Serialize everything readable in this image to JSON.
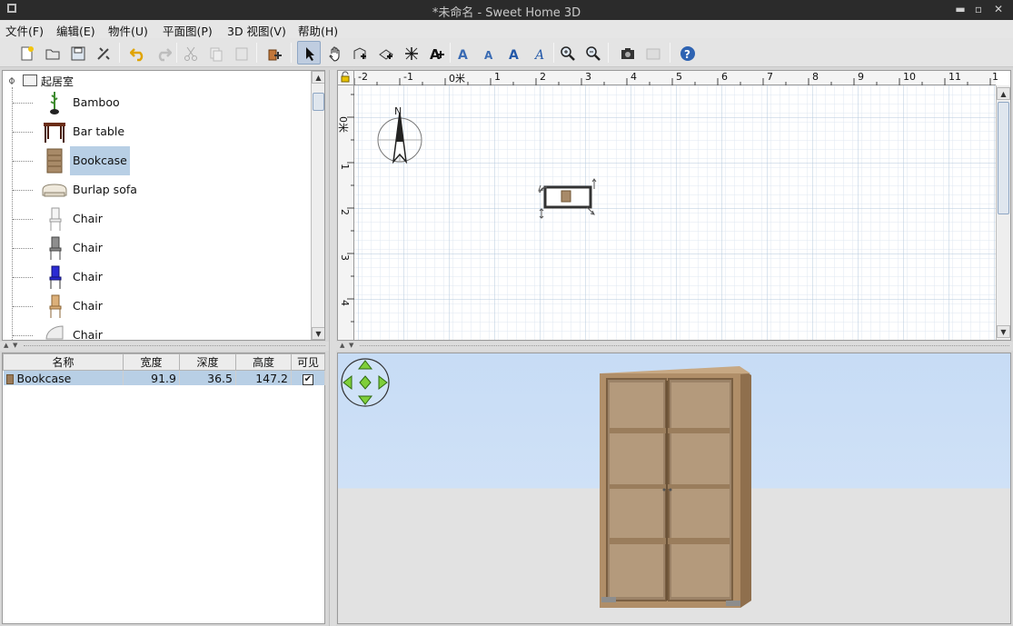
{
  "window": {
    "title": "*未命名 - Sweet Home 3D"
  },
  "menus": [
    "文件(F)",
    "编辑(E)",
    "物件(U)",
    "平面图(P)",
    "3D 视图(V)",
    "帮助(H)"
  ],
  "catalog": {
    "category": "起居室",
    "items": [
      {
        "label": "Bamboo",
        "icon": "bamboo-plant-icon",
        "selected": false
      },
      {
        "label": "Bar table",
        "icon": "bar-table-icon",
        "selected": false
      },
      {
        "label": "Bookcase",
        "icon": "bookcase-icon",
        "selected": true
      },
      {
        "label": "Burlap sofa",
        "icon": "sofa-icon",
        "selected": false
      },
      {
        "label": "Chair",
        "icon": "white-chair-icon",
        "selected": false
      },
      {
        "label": "Chair",
        "icon": "grey-chair-icon",
        "selected": false
      },
      {
        "label": "Chair",
        "icon": "blue-chair-icon",
        "selected": false
      },
      {
        "label": "Chair",
        "icon": "wooden-chair-icon",
        "selected": false
      },
      {
        "label": "Chair",
        "icon": "shell-chair-icon",
        "selected": false
      }
    ]
  },
  "furniture_table": {
    "columns": [
      "名称",
      "宽度",
      "深度",
      "高度",
      "可见"
    ],
    "rows": [
      {
        "name": "Bookcase",
        "width": "91.9",
        "depth": "36.5",
        "height": "147.2",
        "visible": "✔"
      }
    ]
  },
  "plan": {
    "ruler_h": [
      "-2",
      "-1",
      "0米",
      "1",
      "2",
      "3",
      "4",
      "5",
      "6",
      "7",
      "8",
      "9",
      "10",
      "11",
      "1"
    ],
    "ruler_v": [
      "0米",
      "1",
      "2",
      "3",
      "4"
    ],
    "compass_label": "N"
  },
  "colors": {
    "selection": "#b8cfe5",
    "sky": "#c7dcf5",
    "ground": "#e2e2e2",
    "wood": "#b08e68"
  }
}
